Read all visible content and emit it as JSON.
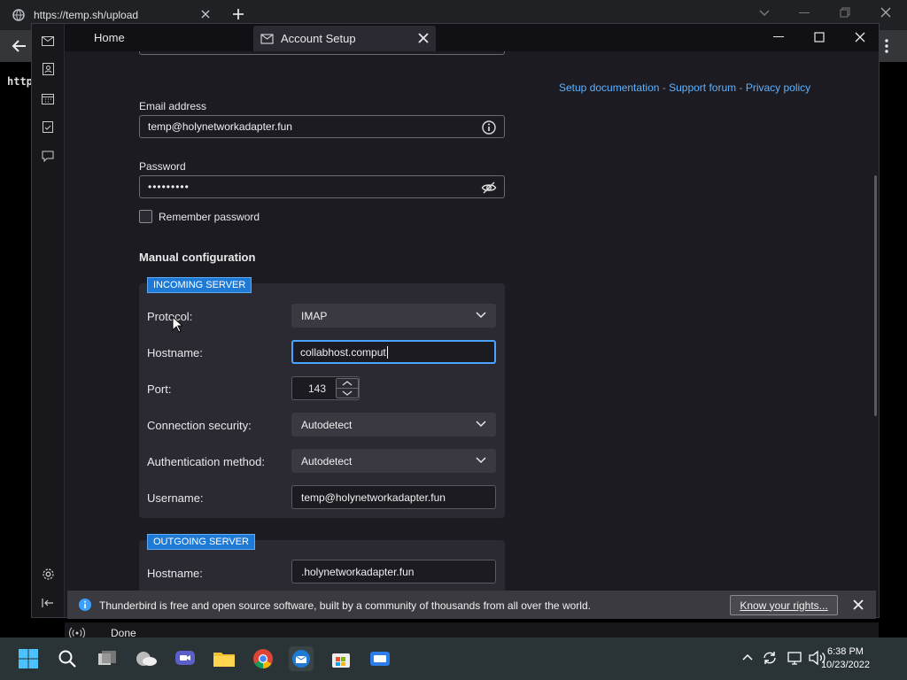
{
  "browser": {
    "tab_title": "https://temp.sh/upload",
    "content_text": "http"
  },
  "thunderbird": {
    "tabs": {
      "home": "Home",
      "account_setup": "Account Setup"
    },
    "links": {
      "setup_docs": "Setup documentation",
      "support": "Support forum",
      "privacy": "Privacy policy",
      "sep": " - "
    },
    "email": {
      "label": "Email address",
      "value": "temp@holynetworkadapter.fun"
    },
    "password": {
      "label": "Password",
      "value": "•••••••••"
    },
    "remember": {
      "label": "Remember password"
    },
    "manual_config": {
      "heading": "Manual configuration"
    },
    "incoming": {
      "badge": "INCOMING SERVER",
      "protocol": {
        "label": "Protocol:",
        "value": "IMAP"
      },
      "hostname": {
        "label": "Hostname:",
        "value": "collabhost.comput"
      },
      "port": {
        "label": "Port:",
        "value": "143"
      },
      "security": {
        "label": "Connection security:",
        "value": "Autodetect"
      },
      "auth": {
        "label": "Authentication method:",
        "value": "Autodetect"
      },
      "username": {
        "label": "Username:",
        "value": "temp@holynetworkadapter.fun"
      }
    },
    "outgoing": {
      "badge": "OUTGOING SERVER",
      "hostname": {
        "label": "Hostname:",
        "value": ".holynetworkadapter.fun"
      }
    },
    "notification": {
      "text": "Thunderbird is free and open source software, built by a community of thousands from all over the world.",
      "button": "Know your rights..."
    },
    "status": {
      "text": "Done"
    }
  },
  "taskbar": {
    "time": "6:38 PM",
    "date": "10/23/2022"
  },
  "colors": {
    "accent": "#1f7ad6",
    "link": "#5eb3ff",
    "focus": "#4aa4ff"
  }
}
